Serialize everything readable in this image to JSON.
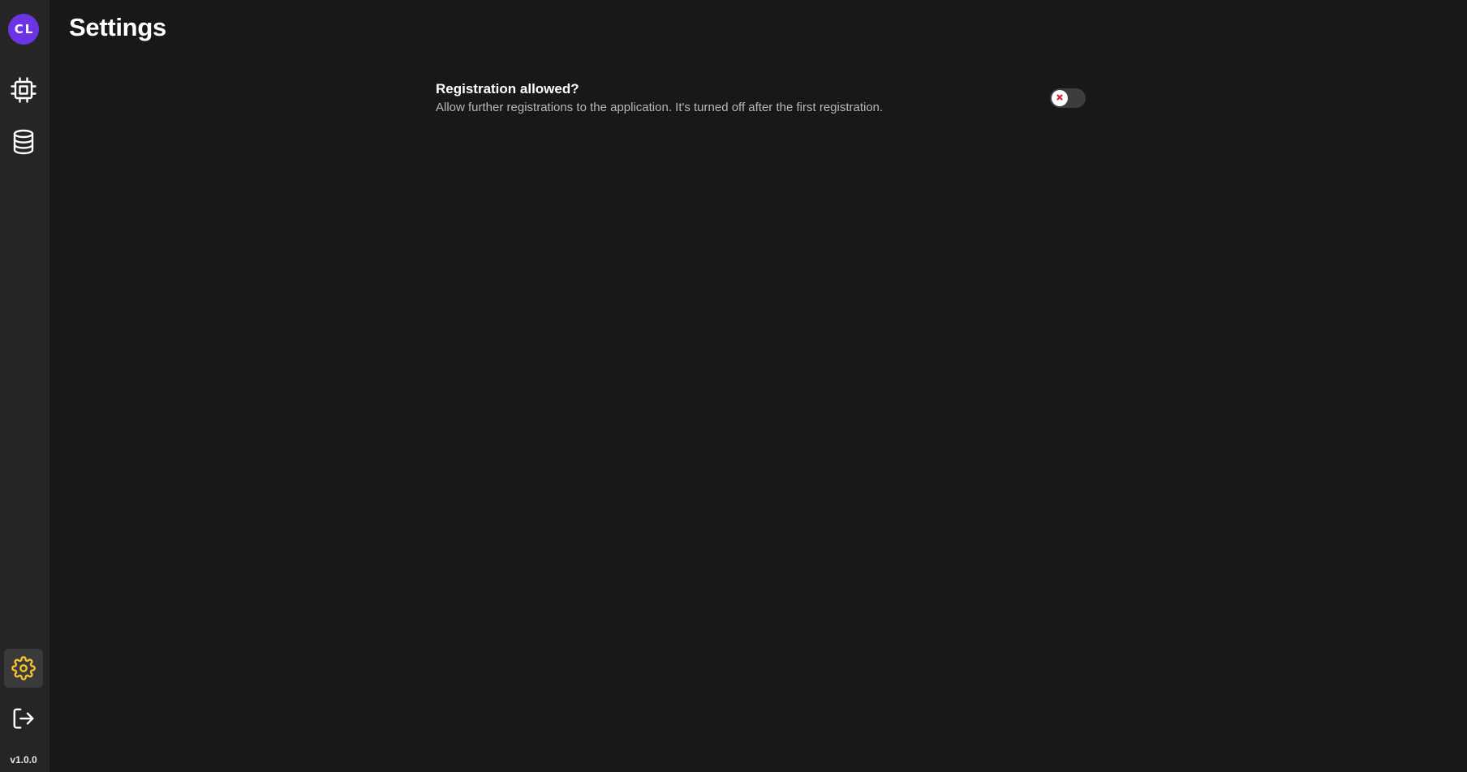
{
  "sidebar": {
    "avatar_initials": "CL",
    "avatar_color": "#6b35e6",
    "items": [
      {
        "name": "devices",
        "icon": "cpu-icon"
      },
      {
        "name": "database",
        "icon": "database-icon"
      }
    ],
    "bottom_items": [
      {
        "name": "settings",
        "icon": "gear-icon",
        "active": true,
        "color": "#f2c230"
      },
      {
        "name": "logout",
        "icon": "logout-icon"
      }
    ],
    "version": "v1.0.0"
  },
  "header": {
    "title": "Settings"
  },
  "settings": [
    {
      "title": "Registration allowed?",
      "description": "Allow further registrations to the application. It's turned off after the first registration.",
      "enabled": false
    }
  ],
  "colors": {
    "background": "#181818",
    "sidebar": "#252525",
    "accent": "#f2c230",
    "toggle_off_mark": "#e0243a"
  }
}
